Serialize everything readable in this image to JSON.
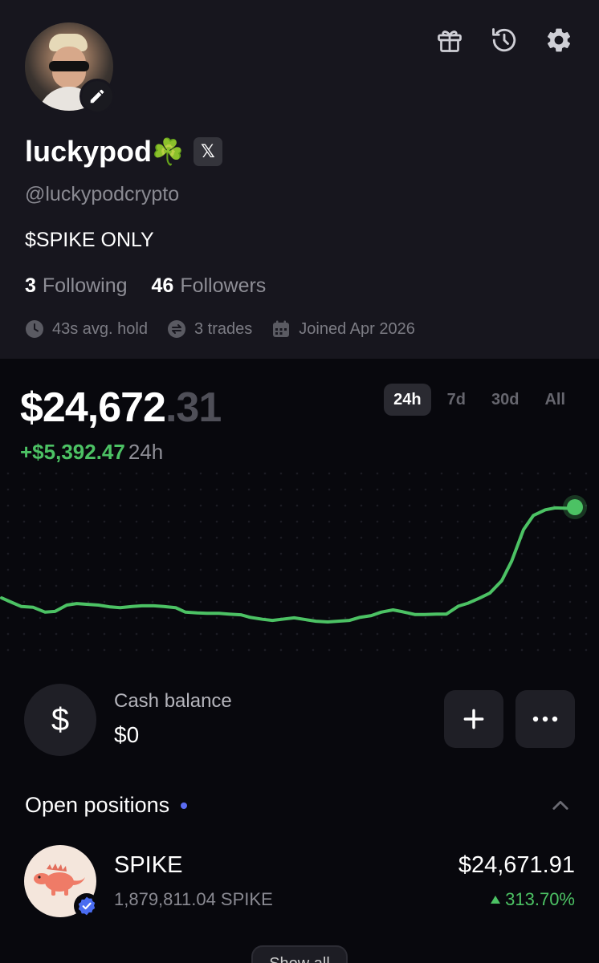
{
  "profile": {
    "display_name": "luckypod",
    "name_emoji": "☘️",
    "x_badge": "𝕏",
    "handle": "@luckypodcrypto",
    "bio": "$SPIKE ONLY",
    "following_count": "3",
    "following_label": "Following",
    "followers_count": "46",
    "followers_label": "Followers",
    "avg_hold": "43s avg. hold",
    "trades": "3 trades",
    "joined": "Joined Apr 2026"
  },
  "header_icons": [
    "gift-icon",
    "history-icon",
    "settings-icon"
  ],
  "portfolio": {
    "value_main": "$24,672",
    "value_cents": ".31",
    "change_amount": "+$5,392.47",
    "change_period": "24h",
    "ranges": [
      "24h",
      "7d",
      "30d",
      "All"
    ],
    "selected_range": "24h"
  },
  "colors": {
    "accent_green": "#4cc264",
    "background": "#08080d",
    "profile_bg": "#17161e"
  },
  "chart_data": {
    "type": "line",
    "title": "",
    "xlabel": "",
    "ylabel": "",
    "grid": false,
    "points": [
      [
        0,
        19020
      ],
      [
        5,
        18905
      ],
      [
        10,
        18790
      ],
      [
        16,
        18770
      ],
      [
        22,
        18640
      ],
      [
        27,
        18660
      ],
      [
        33,
        18830
      ],
      [
        38,
        18870
      ],
      [
        43,
        18850
      ],
      [
        49,
        18830
      ],
      [
        55,
        18780
      ],
      [
        60,
        18760
      ],
      [
        66,
        18790
      ],
      [
        71,
        18810
      ],
      [
        77,
        18810
      ],
      [
        82,
        18790
      ],
      [
        88,
        18760
      ],
      [
        93,
        18640
      ],
      [
        99,
        18620
      ],
      [
        104,
        18610
      ],
      [
        110,
        18610
      ],
      [
        115,
        18590
      ],
      [
        121,
        18570
      ],
      [
        126,
        18500
      ],
      [
        132,
        18450
      ],
      [
        137,
        18420
      ],
      [
        143,
        18460
      ],
      [
        148,
        18490
      ],
      [
        154,
        18440
      ],
      [
        159,
        18400
      ],
      [
        165,
        18380
      ],
      [
        170,
        18400
      ],
      [
        176,
        18420
      ],
      [
        181,
        18500
      ],
      [
        187,
        18550
      ],
      [
        192,
        18640
      ],
      [
        198,
        18700
      ],
      [
        203,
        18650
      ],
      [
        209,
        18580
      ],
      [
        214,
        18580
      ],
      [
        220,
        18590
      ],
      [
        225,
        18590
      ],
      [
        231,
        18800
      ],
      [
        236,
        18880
      ],
      [
        242,
        19020
      ],
      [
        247,
        19150
      ],
      [
        253,
        19480
      ],
      [
        258,
        20000
      ],
      [
        264,
        20840
      ],
      [
        269,
        21220
      ],
      [
        275,
        21370
      ],
      [
        280,
        21420
      ],
      [
        286,
        21410
      ],
      [
        290,
        21440
      ]
    ],
    "last_value": 21440
  },
  "cash": {
    "icon": "$",
    "label": "Cash balance",
    "value": "$0"
  },
  "positions": {
    "title": "Open positions",
    "items": [
      {
        "name": "SPIKE",
        "quantity": "1,879,811.04 SPIKE",
        "value": "$24,671.91",
        "change_pct": "313.70%"
      }
    ],
    "show_all_label": "Show all"
  }
}
